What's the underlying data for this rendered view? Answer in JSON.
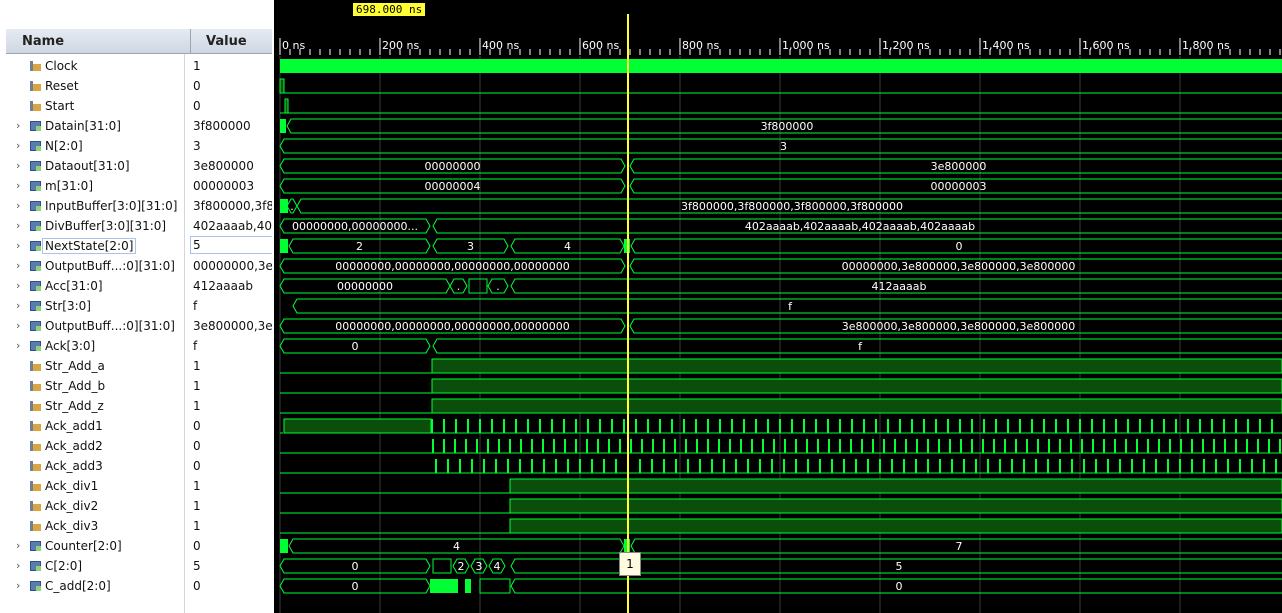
{
  "header": {
    "name_label": "Name",
    "value_label": "Value"
  },
  "cursor": {
    "label": "698.000 ns"
  },
  "tooltip": {
    "text": "1"
  },
  "ruler": [
    "0 ns",
    "200 ns",
    "400 ns",
    "600 ns",
    "800 ns",
    "1,000 ns",
    "1,200 ns",
    "1,400 ns",
    "1,600 ns",
    "1,800 ns"
  ],
  "signals": [
    {
      "name": "Clock",
      "value": "1",
      "type": "bit",
      "expand": false
    },
    {
      "name": "Reset",
      "value": "0",
      "type": "bit",
      "expand": false
    },
    {
      "name": "Start",
      "value": "0",
      "type": "bit",
      "expand": false
    },
    {
      "name": "Datain[31:0]",
      "value": "3f800000",
      "type": "bus",
      "expand": true
    },
    {
      "name": "N[2:0]",
      "value": "3",
      "type": "bus",
      "expand": true
    },
    {
      "name": "Dataout[31:0]",
      "value": "3e800000",
      "type": "bus",
      "expand": true
    },
    {
      "name": "m[31:0]",
      "value": "00000003",
      "type": "bus",
      "expand": true
    },
    {
      "name": "InputBuffer[3:0][31:0]",
      "value": "3f800000,3f8",
      "type": "bus",
      "expand": true
    },
    {
      "name": "DivBuffer[3:0][31:0]",
      "value": "402aaaab,40",
      "type": "bus",
      "expand": true
    },
    {
      "name": "NextState[2:0]",
      "value": "5",
      "type": "bus",
      "expand": true,
      "selected": true
    },
    {
      "name": "OutputBuff...:0][31:0]",
      "value": "00000000,3e",
      "type": "bus",
      "expand": true
    },
    {
      "name": "Acc[31:0]",
      "value": "412aaaab",
      "type": "bus",
      "expand": true
    },
    {
      "name": "Str[3:0]",
      "value": "f",
      "type": "bus",
      "expand": true
    },
    {
      "name": "OutputBuff...:0][31:0]",
      "value": "3e800000,3e",
      "type": "bus",
      "expand": true
    },
    {
      "name": "Ack[3:0]",
      "value": "f",
      "type": "bus",
      "expand": true
    },
    {
      "name": "Str_Add_a",
      "value": "1",
      "type": "bit",
      "expand": false
    },
    {
      "name": "Str_Add_b",
      "value": "1",
      "type": "bit",
      "expand": false
    },
    {
      "name": "Str_Add_z",
      "value": "1",
      "type": "bit",
      "expand": false
    },
    {
      "name": "Ack_add1",
      "value": "0",
      "type": "bit",
      "expand": false
    },
    {
      "name": "Ack_add2",
      "value": "0",
      "type": "bit",
      "expand": false
    },
    {
      "name": "Ack_add3",
      "value": "0",
      "type": "bit",
      "expand": false
    },
    {
      "name": "Ack_div1",
      "value": "1",
      "type": "bit",
      "expand": false
    },
    {
      "name": "Ack_div2",
      "value": "1",
      "type": "bit",
      "expand": false
    },
    {
      "name": "Ack_div3",
      "value": "1",
      "type": "bit",
      "expand": false
    },
    {
      "name": "Counter[2:0]",
      "value": "0",
      "type": "bus",
      "expand": true
    },
    {
      "name": "C[2:0]",
      "value": "5",
      "type": "bus",
      "expand": true
    },
    {
      "name": "C_add[2:0]",
      "value": "0",
      "type": "bus",
      "expand": true
    }
  ],
  "wave_labels": [
    {
      "row": 3,
      "segments": [
        {
          "from": 12,
          "to": 1012,
          "text": "3f800000"
        }
      ]
    },
    {
      "row": 4,
      "segments": [
        {
          "from": 5,
          "to": 1012,
          "text": "3"
        }
      ]
    },
    {
      "row": 5,
      "segments": [
        {
          "from": 5,
          "to": 350,
          "text": "00000000"
        },
        {
          "from": 355,
          "to": 1012,
          "text": "3e800000"
        }
      ]
    },
    {
      "row": 6,
      "segments": [
        {
          "from": 5,
          "to": 350,
          "text": "00000004"
        },
        {
          "from": 355,
          "to": 1012,
          "text": "00000003"
        }
      ]
    },
    {
      "row": 7,
      "segments": [
        {
          "from": 12,
          "to": 22,
          "text": "."
        },
        {
          "from": 22,
          "to": 1012,
          "text": "3f800000,3f800000,3f800000,3f800000"
        }
      ]
    },
    {
      "row": 8,
      "segments": [
        {
          "from": 5,
          "to": 155,
          "text": "00000000,00000000..."
        },
        {
          "from": 158,
          "to": 1012,
          "text": "402aaaab,402aaaab,402aaaab,402aaaab"
        }
      ]
    },
    {
      "row": 9,
      "segments": [
        {
          "from": 14,
          "to": 155,
          "text": "2"
        },
        {
          "from": 158,
          "to": 233,
          "text": "3"
        },
        {
          "from": 236,
          "to": 349,
          "text": "4"
        },
        {
          "from": 356,
          "to": 1012,
          "text": "0"
        }
      ]
    },
    {
      "row": 10,
      "segments": [
        {
          "from": 5,
          "to": 350,
          "text": "00000000,00000000,00000000,00000000"
        },
        {
          "from": 355,
          "to": 1012,
          "text": "00000000,3e800000,3e800000,3e800000"
        }
      ]
    },
    {
      "row": 11,
      "segments": [
        {
          "from": 5,
          "to": 175,
          "text": "00000000"
        },
        {
          "from": 175,
          "to": 192,
          "text": "."
        },
        {
          "from": 213,
          "to": 233,
          "text": "."
        },
        {
          "from": 236,
          "to": 1012,
          "text": "412aaaab"
        }
      ]
    },
    {
      "row": 12,
      "segments": [
        {
          "from": 18,
          "to": 1012,
          "text": "f"
        }
      ]
    },
    {
      "row": 13,
      "segments": [
        {
          "from": 5,
          "to": 350,
          "text": "00000000,00000000,00000000,00000000"
        },
        {
          "from": 355,
          "to": 1012,
          "text": "3e800000,3e800000,3e800000,3e800000"
        }
      ]
    },
    {
      "row": 14,
      "segments": [
        {
          "from": 5,
          "to": 155,
          "text": "0"
        },
        {
          "from": 158,
          "to": 1012,
          "text": "f"
        }
      ]
    },
    {
      "row": 24,
      "segments": [
        {
          "from": 14,
          "to": 349,
          "text": "4"
        },
        {
          "from": 356,
          "to": 1012,
          "text": "7"
        }
      ]
    },
    {
      "row": 25,
      "segments": [
        {
          "from": 5,
          "to": 155,
          "text": "0"
        },
        {
          "from": 178,
          "to": 194,
          "text": "2"
        },
        {
          "from": 196,
          "to": 212,
          "text": "3"
        },
        {
          "from": 214,
          "to": 230,
          "text": "4"
        },
        {
          "from": 236,
          "to": 1012,
          "text": "5"
        }
      ]
    },
    {
      "row": 26,
      "segments": [
        {
          "from": 5,
          "to": 155,
          "text": "0"
        },
        {
          "from": 236,
          "to": 1012,
          "text": "0"
        }
      ]
    }
  ]
}
